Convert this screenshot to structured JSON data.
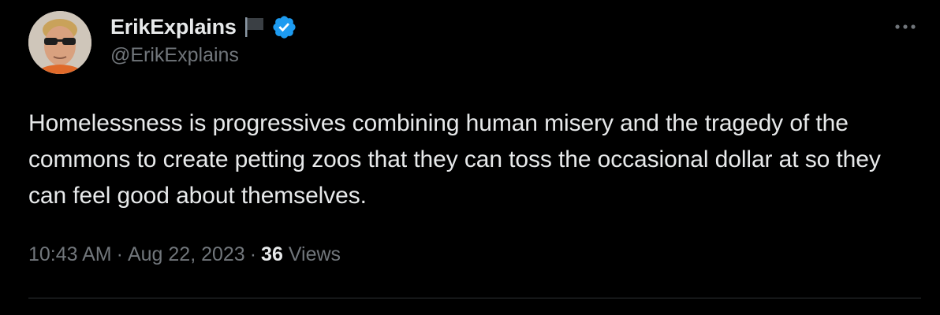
{
  "author": {
    "display_name": "ErikExplains",
    "handle": "@ErikExplains",
    "flag_icon": "black-flag-icon",
    "verified_icon": "verified-badge-icon",
    "verified_color": "#1d9bf0"
  },
  "tweet": {
    "text": "Homelessness is progressives combining human misery and the tragedy of the commons to create petting zoos that they can toss the occasional dollar at so they can feel good about themselves.",
    "time": "10:43 AM",
    "separator": "·",
    "date": "Aug 22, 2023",
    "views_count": "36",
    "views_label": "Views"
  },
  "toolbar": {
    "more_icon": "more-options-icon"
  },
  "colors": {
    "background": "#000000",
    "text_primary": "#e7e9ea",
    "text_secondary": "#71767b",
    "divider": "#2f3336",
    "accent": "#1d9bf0"
  }
}
